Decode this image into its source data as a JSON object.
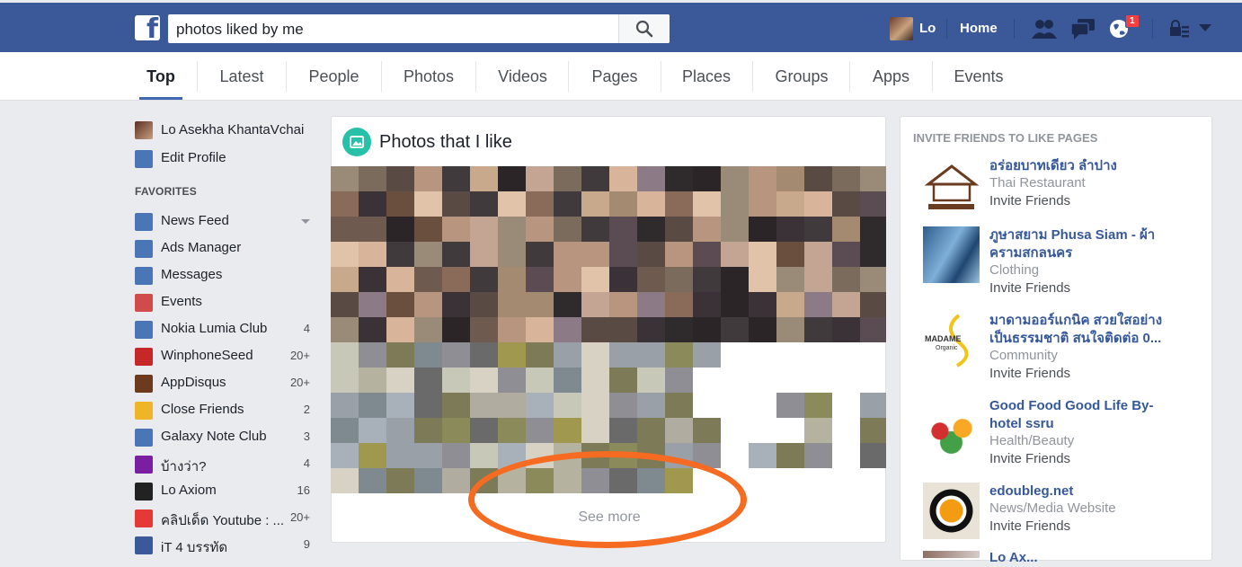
{
  "topbar": {
    "search_query": "photos liked by me",
    "user_name": "Lo",
    "home_label": "Home",
    "notification_count": "1"
  },
  "tabs": [
    "Top",
    "Latest",
    "People",
    "Photos",
    "Videos",
    "Pages",
    "Places",
    "Groups",
    "Apps",
    "Events"
  ],
  "left_nav": {
    "profile_name": "Lo Asekha KhantaVchai",
    "edit_profile": "Edit Profile",
    "favorites_heading": "FAVORITES",
    "items": [
      {
        "label": "News Feed",
        "count": "",
        "icon": "news-feed-icon",
        "color": "#4a76b8"
      },
      {
        "label": "Ads Manager",
        "count": "",
        "icon": "ads-manager-icon",
        "color": "#4a76b8"
      },
      {
        "label": "Messages",
        "count": "",
        "icon": "messages-icon",
        "color": "#4a76b8"
      },
      {
        "label": "Events",
        "count": "",
        "icon": "events-icon",
        "color": "#d24b4b"
      },
      {
        "label": "Nokia Lumia Club",
        "count": "4",
        "icon": "group-icon",
        "color": "#4a76b8"
      },
      {
        "label": "WinphoneSeed",
        "count": "20+",
        "icon": "winphoneseed-icon",
        "color": "#c62828"
      },
      {
        "label": "AppDisqus",
        "count": "20+",
        "icon": "appdisqus-icon",
        "color": "#6d3a1e"
      },
      {
        "label": "Close Friends",
        "count": "2",
        "icon": "star-icon",
        "color": "#f0b429"
      },
      {
        "label": "Galaxy Note Club",
        "count": "3",
        "icon": "group-icon",
        "color": "#4a76b8"
      },
      {
        "label": "บ้างว่า?",
        "count": "4",
        "icon": "page-icon",
        "color": "#7b1fa2"
      },
      {
        "label": "Lo Axiom",
        "count": "16",
        "icon": "profile-icon",
        "color": "#222222"
      },
      {
        "label": "คลิปเด็ด Youtube : ...",
        "count": "20+",
        "icon": "youtube-icon",
        "color": "#e53935"
      },
      {
        "label": "iT 4 บรรทัด",
        "count": "9",
        "icon": "it4-icon",
        "color": "#3b5998"
      }
    ]
  },
  "main": {
    "title": "Photos that I like",
    "see_more": "See more"
  },
  "right": {
    "heading": "INVITE FRIENDS TO LIKE PAGES",
    "pages": [
      {
        "name": "อร่อยบาทเดียว ลำปาง",
        "category": "Thai Restaurant",
        "invite": "Invite Friends"
      },
      {
        "name": "ภูษาสยาม Phusa Siam - ผ้าครามสกลนคร",
        "category": "Clothing",
        "invite": "Invite Friends"
      },
      {
        "name": "มาดามออร์แกนิค สวยใสอย่างเป็นธรรมชาติ สนใจติดต่อ 0...",
        "category": "Community",
        "invite": "Invite Friends"
      },
      {
        "name": "Good Food Good Life By-hotel ssru",
        "category": "Health/Beauty",
        "invite": "Invite Friends"
      },
      {
        "name": "edoubleg.net",
        "category": "News/Media Website",
        "invite": "Invite Friends"
      }
    ],
    "partial_name": "Lo Ax..."
  }
}
